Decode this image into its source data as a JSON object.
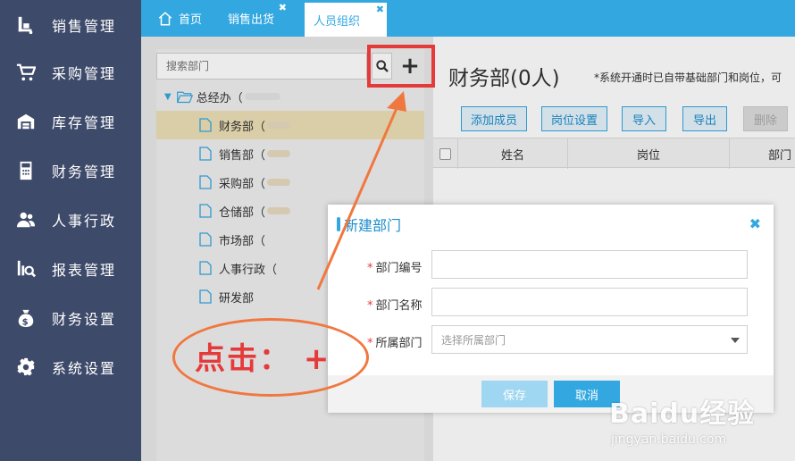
{
  "sidebar": {
    "items": [
      {
        "label": "销售管理",
        "icon": "sales-icon"
      },
      {
        "label": "采购管理",
        "icon": "cart-icon"
      },
      {
        "label": "库存管理",
        "icon": "warehouse-icon"
      },
      {
        "label": "财务管理",
        "icon": "calculator-icon"
      },
      {
        "label": "人事行政",
        "icon": "users-icon"
      },
      {
        "label": "报表管理",
        "icon": "report-icon"
      },
      {
        "label": "财务设置",
        "icon": "money-bag-icon"
      },
      {
        "label": "系统设置",
        "icon": "gear-icon"
      }
    ]
  },
  "tabs": [
    {
      "label": "首页",
      "icon": "home-icon"
    },
    {
      "label": "销售出货"
    },
    {
      "label": "人员组织",
      "active": true
    }
  ],
  "search": {
    "placeholder": "搜索部门"
  },
  "add_button_label": "+",
  "tree": {
    "root": "总经办（",
    "items": [
      {
        "label": "财务部（"
      },
      {
        "label": "销售部（"
      },
      {
        "label": "采购部（"
      },
      {
        "label": "仓储部（"
      },
      {
        "label": "市场部（"
      },
      {
        "label": "人事行政（"
      },
      {
        "label": "研发部"
      }
    ]
  },
  "dept_panel": {
    "title": "财务部(0人)",
    "note": "*系统开通时已自带基础部门和岗位，可",
    "buttons": {
      "add_member": "添加成员",
      "post_settings": "岗位设置",
      "import": "导入",
      "export": "导出",
      "delete": "删除"
    },
    "columns": {
      "name": "姓名",
      "post": "岗位",
      "dept": "部门"
    }
  },
  "modal": {
    "title": "新建部门",
    "close_symbol": "✖",
    "fields": {
      "code": {
        "label": "部门编号",
        "value": ""
      },
      "name": {
        "label": "部门名称",
        "value": ""
      },
      "parent": {
        "label": "所属部门",
        "placeholder": "选择所属部门"
      }
    },
    "required_mark": "*",
    "save": "保存",
    "cancel": "取消"
  },
  "annotation": {
    "text": "点击：  +"
  },
  "watermark": {
    "logo": "Baidu经验",
    "url": "jingyan.baidu.com"
  },
  "colors": {
    "sidebar_bg": "#3e4a6a",
    "accent": "#33a8e0",
    "selected_row": "#ede0b7",
    "annotation_red": "#e53a3a",
    "annotation_orange": "#f07840"
  }
}
